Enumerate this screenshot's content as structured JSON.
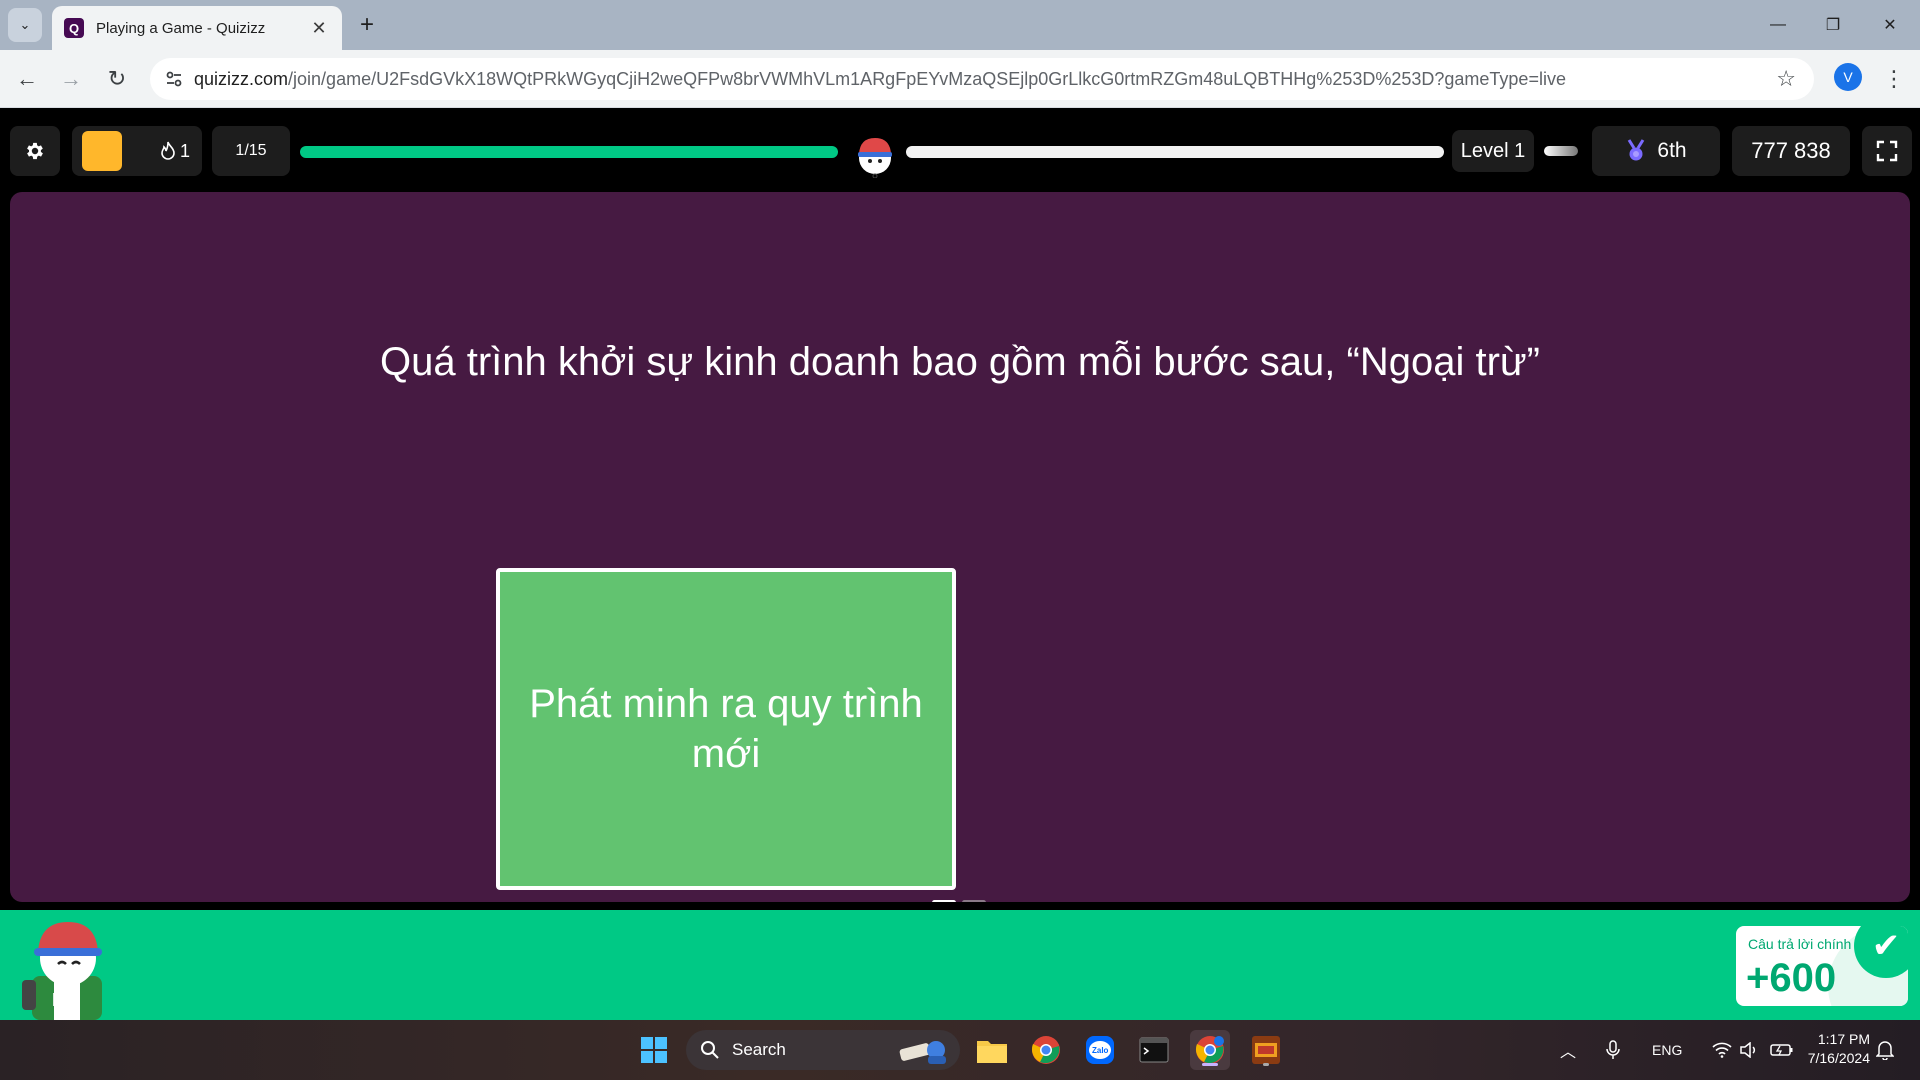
{
  "browser": {
    "tab_title": "Playing a Game - Quizizz",
    "favicon_letter": "Q",
    "url_host": "quizizz.com",
    "url_path": "/join/game/U2FsdGVkX18WQtPRkWGyqCjiH2weQFPw8brVWMhVLm1ARgFpEYvMzaQSEjlp0GrLlkcG0rtmRZGm48uLQBTHHg%253D%253D?gameType=live",
    "profile_initial": "V",
    "window_controls": [
      "minimize",
      "restore",
      "close"
    ]
  },
  "game": {
    "streak_count": "1",
    "question_counter": "1/15",
    "progress_fraction": 1.0,
    "level_label": "Level 1",
    "rank_label": "6th",
    "score": "777 838",
    "powerup_color": "#ffb72b",
    "progress_color": "#00c985"
  },
  "question": {
    "text": "Quá trình khởi sự kinh doanh bao gồm mỗi bước sau, “Ngoại trừ”",
    "option_text": "Phát minh ra quy trình mới",
    "option_color": "#62c370",
    "stage_color": "#461a42"
  },
  "feedback": {
    "label": "Câu trả lời chính",
    "points": "+600",
    "bar_color": "#00c985"
  },
  "taskbar": {
    "search_label": "Search",
    "language": "ENG",
    "time": "1:17 PM",
    "date": "7/16/2024"
  }
}
